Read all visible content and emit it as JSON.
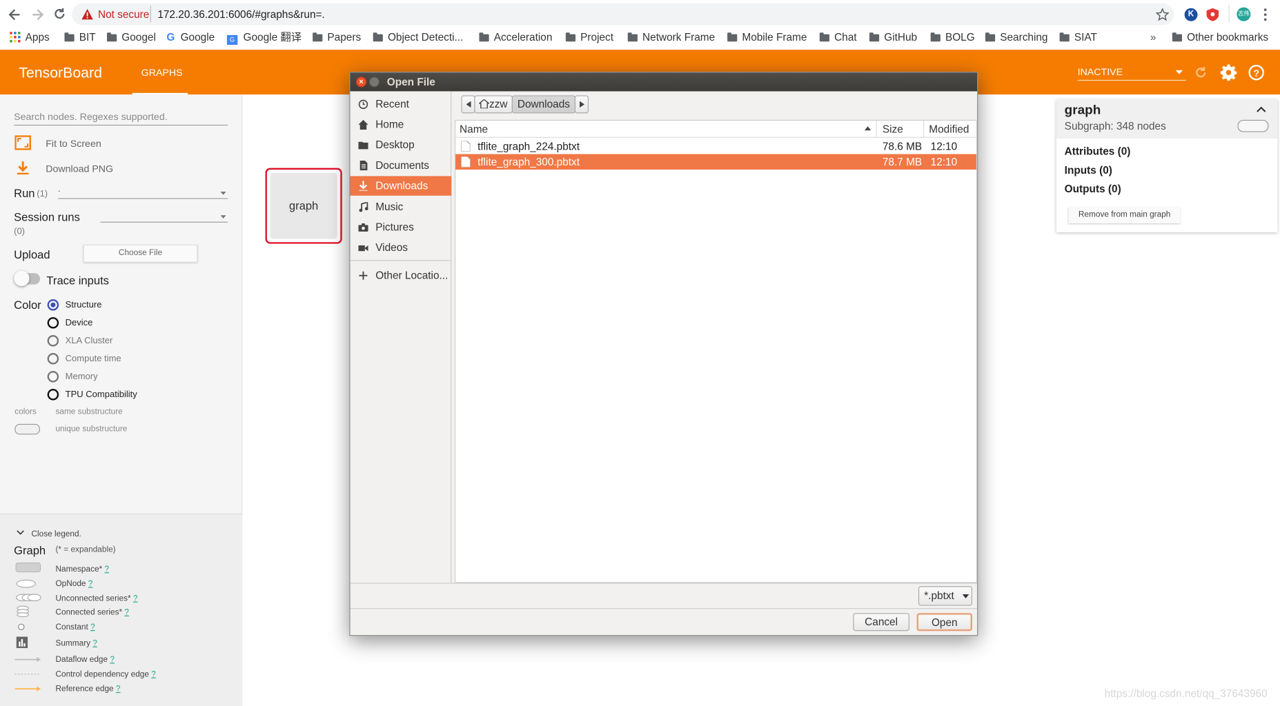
{
  "browser": {
    "security_label": "Not secure",
    "url": "172.20.36.201:6006/#graphs&run=.",
    "bookmarks": [
      "Apps",
      "BIT",
      "Googel",
      "Google",
      "Google 翻译",
      "Papers",
      "Object Detecti...",
      "Acceleration",
      "Project",
      "Network Frame",
      "Mobile Frame",
      "Chat",
      "GitHub",
      "BOLG",
      "Searching",
      "SIAT"
    ],
    "overflow": "»",
    "other_bookmarks": "Other bookmarks",
    "profile_initials": "志伟"
  },
  "header": {
    "title": "TensorBoard",
    "tab": "GRAPHS",
    "run_status": "INACTIVE"
  },
  "sidebar": {
    "search_placeholder": "Search nodes. Regexes supported.",
    "fit_label": "Fit to Screen",
    "download_label": "Download PNG",
    "run_label": "Run",
    "run_count": "(1)",
    "run_value": ".",
    "session_label": "Session runs",
    "session_count": "(0)",
    "upload_label": "Upload",
    "choose_file": "Choose File",
    "trace_label": "Trace inputs",
    "color_label": "Color",
    "color_options": [
      "Structure",
      "Device",
      "XLA Cluster",
      "Compute time",
      "Memory",
      "TPU Compatibility"
    ],
    "colors_label": "colors",
    "same_sub": "same substructure",
    "unique_sub": "unique substructure"
  },
  "legend": {
    "close_label": "Close legend.",
    "graph_label": "Graph",
    "expandable_note": "(* = expandable)",
    "items": [
      "Namespace*",
      "OpNode",
      "Unconnected series*",
      "Connected series*",
      "Constant",
      "Summary",
      "Dataflow edge",
      "Control dependency edge",
      "Reference edge"
    ],
    "help": "?"
  },
  "canvas": {
    "node_label": "graph"
  },
  "dialog": {
    "title": "Open File",
    "places": [
      "Recent",
      "Home",
      "Desktop",
      "Documents",
      "Downloads",
      "Music",
      "Pictures",
      "Videos"
    ],
    "other_locations": "Other Locatio...",
    "path": [
      "zzw",
      "Downloads"
    ],
    "columns": {
      "name": "Name",
      "size": "Size",
      "modified": "Modified"
    },
    "files": [
      {
        "name": "tflite_graph_224.pbtxt",
        "size": "78.6 MB",
        "modified": "12:10"
      },
      {
        "name": "tflite_graph_300.pbtxt",
        "size": "78.7 MB",
        "modified": "12:10"
      }
    ],
    "filter": "*.pbtxt",
    "cancel": "Cancel",
    "open": "Open"
  },
  "info": {
    "title": "graph",
    "subtitle": "Subgraph: 348 nodes",
    "attributes": "Attributes (0)",
    "inputs": "Inputs (0)",
    "outputs": "Outputs (0)",
    "remove_button": "Remove from main graph"
  },
  "watermark": "https://blog.csdn.net/qq_37643960",
  "colors": {
    "accent": "#f57c00",
    "selection": "#f07746",
    "radio": "#3f51b5",
    "node_border": "#e0102a"
  }
}
